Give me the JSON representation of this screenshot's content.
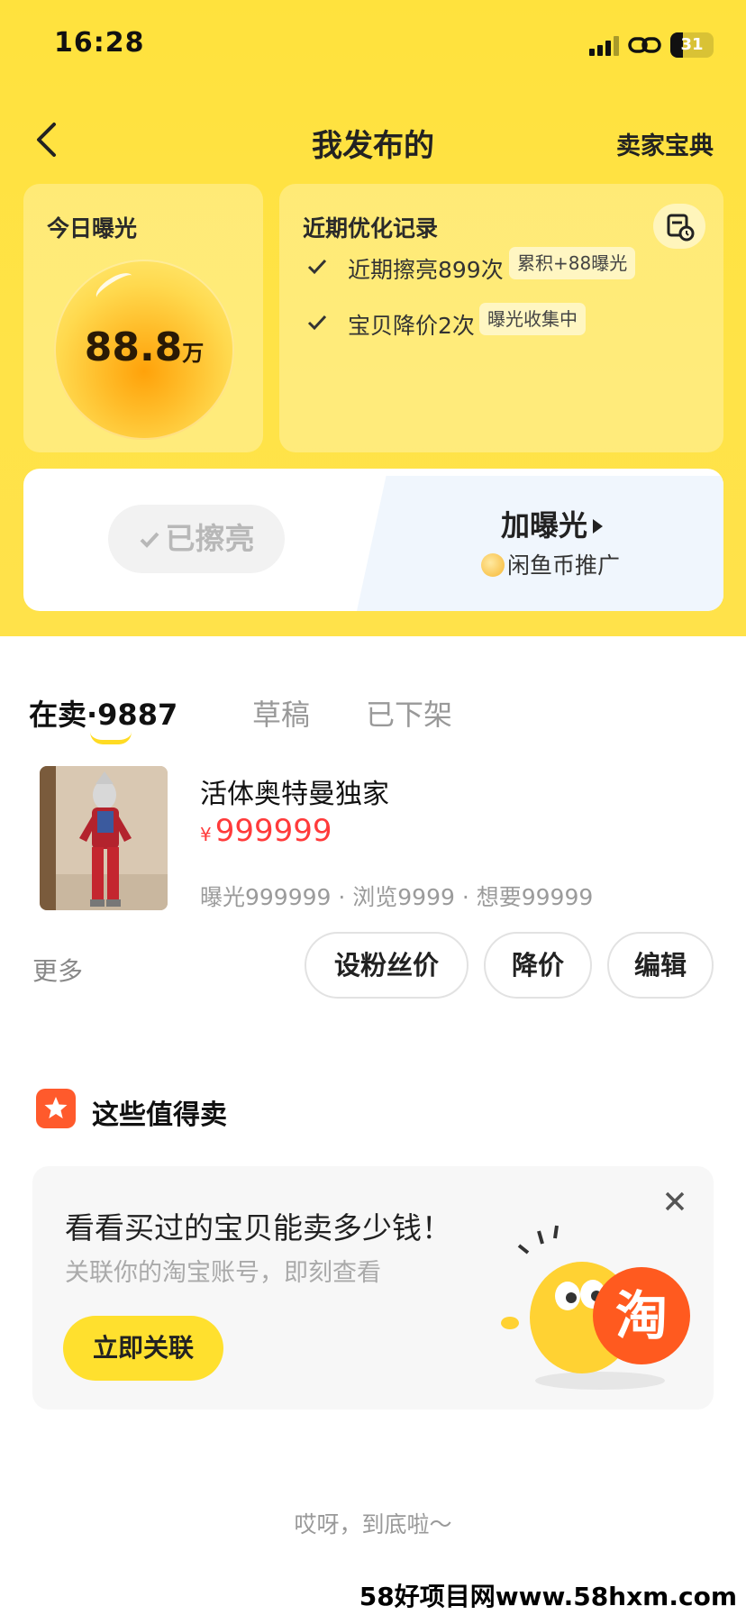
{
  "status_bar": {
    "time": "16:28",
    "battery": "31"
  },
  "nav": {
    "title": "我发布的",
    "right_link": "卖家宝典"
  },
  "exposure": {
    "label": "今日曝光",
    "value": "88.8",
    "unit": "万"
  },
  "records": {
    "title": "近期优化记录",
    "items": [
      {
        "text": "近期擦亮899次",
        "tag": "累积+88曝光"
      },
      {
        "text": "宝贝降价2次",
        "tag": "曝光收集中"
      }
    ]
  },
  "actions": {
    "polished": "已擦亮",
    "boost": "加曝光",
    "coin_promo": "闲鱼币推广"
  },
  "tabs": [
    {
      "label": "在卖·9887",
      "active": true
    },
    {
      "label": "草稿",
      "active": false
    },
    {
      "label": "已下架",
      "active": false
    }
  ],
  "product": {
    "title": "活体奥特曼独家",
    "currency": "¥",
    "price": "999999",
    "stats": "曝光999999 · 浏览9999 · 想要99999"
  },
  "product_actions": {
    "more": "更多",
    "fan_price": "设粉丝价",
    "reduce_price": "降价",
    "edit": "编辑"
  },
  "worth_selling": {
    "title": "这些值得卖"
  },
  "promo": {
    "title": "看看买过的宝贝能卖多少钱！",
    "subtitle": "关联你的淘宝账号，即刻查看",
    "button": "立即关联",
    "badge_char": "淘"
  },
  "footer": {
    "note": "哎呀，到底啦～"
  },
  "watermark": "58好项目网www.58hxm.com",
  "colors": {
    "brand_yellow": "#ffe23d",
    "price_red": "#ff3b3b",
    "promo_orange": "#ff5a2c"
  }
}
